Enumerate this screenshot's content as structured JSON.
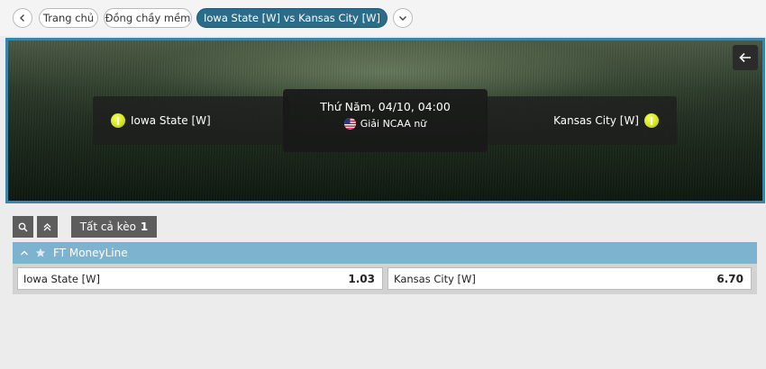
{
  "breadcrumb": {
    "back_icon": "chevron-left-icon",
    "items": [
      "Trang chủ",
      "Đồng chầy mềm",
      "Iowa State [W] vs Kansas City [W]"
    ],
    "expand_icon": "chevron-down-icon"
  },
  "match": {
    "home_team": "Iowa State [W]",
    "away_team": "Kansas City [W]",
    "datetime": "Thứ Năm, 04/10, 04:00",
    "league": "Giải NCAA nữ",
    "league_flag_icon": "us-flag-icon",
    "sport_icon": "softball-icon",
    "back_icon": "arrow-left-icon"
  },
  "toolbar": {
    "search_icon": "search-icon",
    "collapse_icon": "double-chevron-up-icon",
    "all_tab_label": "Tất cả kèo",
    "all_tab_count": "1"
  },
  "market": {
    "title": "FT MoneyLine",
    "collapse_icon": "chevron-up-icon",
    "favorite_icon": "star-icon",
    "odds": [
      {
        "label": "Iowa State [W]",
        "price": "1.03"
      },
      {
        "label": "Kansas City [W]",
        "price": "6.70"
      }
    ]
  },
  "colors": {
    "accent": "#2b6c8a",
    "hero_border": "#3a86a8",
    "market_header": "#7db3cf",
    "tab_dark": "#5d5d5d"
  }
}
